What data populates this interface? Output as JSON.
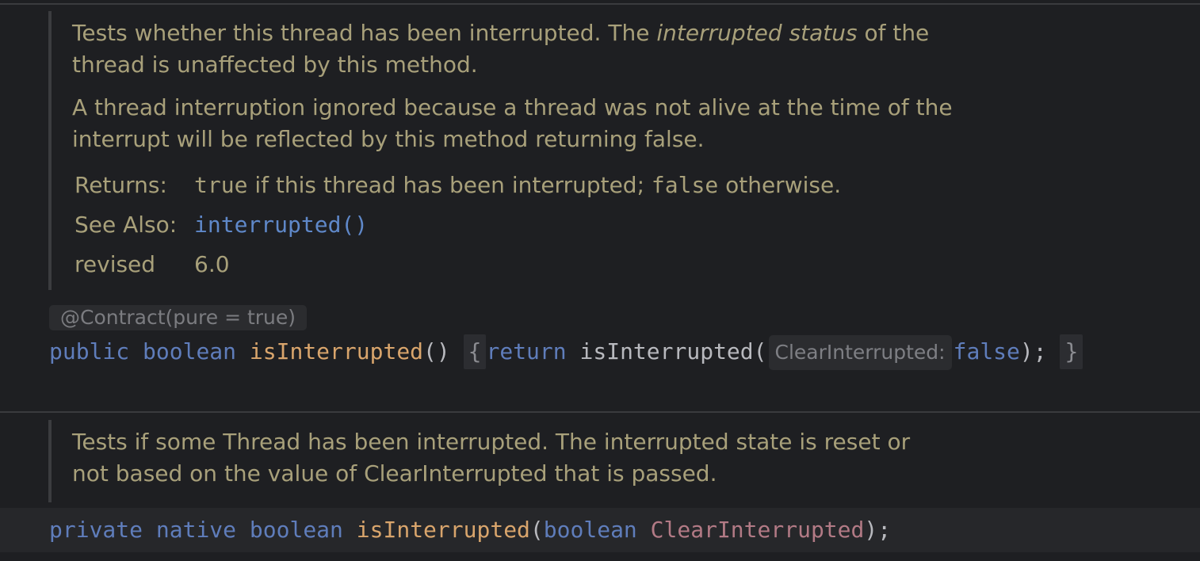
{
  "doc1": {
    "para1_before": "Tests whether this thread has been interrupted. The ",
    "para1_italic": "interrupted status",
    "para1_after": " of the",
    "para1_line2": "thread is unaffected by this method.",
    "para2_line1": "A thread interruption ignored because a thread was not alive at the time of the",
    "para2_line2": "interrupt will be reflected by this method returning false.",
    "returns_label": "Returns:",
    "returns_true": "true",
    "returns_mid": " if this thread has been interrupted; ",
    "returns_false": "false",
    "returns_end": " otherwise.",
    "see_also_label": "See Also:",
    "see_also_link": "interrupted()",
    "revised_label": "revised",
    "revised_value": "6.0"
  },
  "annotation": "@Contract(pure = true)",
  "code1": {
    "kw_public": "public",
    "kw_boolean": "boolean",
    "method": "isInterrupted",
    "parens": "()",
    "open_brace": "{",
    "kw_return": "return",
    "call": "isInterrupted(",
    "hint": "ClearInterrupted:",
    "kw_false": "false",
    "close": ");",
    "close_brace": "}"
  },
  "doc2": {
    "line1": "Tests if some Thread has been interrupted. The interrupted state is reset or",
    "line2": "not based on the value of ClearInterrupted that is passed."
  },
  "code2": {
    "kw_private": "private",
    "kw_native": "native",
    "kw_boolean": "boolean",
    "method": "isInterrupted",
    "open_paren": "(",
    "param_type": "boolean",
    "param_name": "ClearInterrupted",
    "close": ");"
  }
}
